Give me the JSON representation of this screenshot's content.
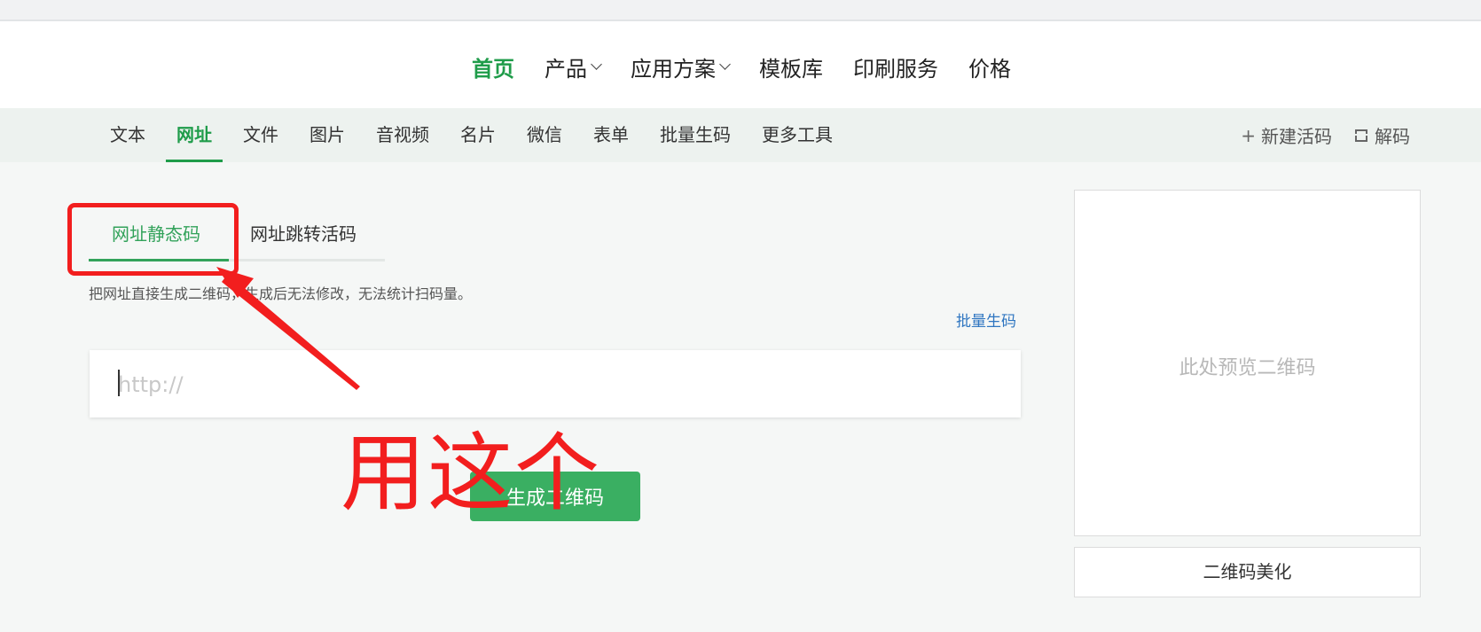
{
  "topnav": {
    "items": [
      {
        "label": "首页",
        "active": true,
        "dropdown": false
      },
      {
        "label": "产品",
        "active": false,
        "dropdown": true
      },
      {
        "label": "应用方案",
        "active": false,
        "dropdown": true
      },
      {
        "label": "模板库",
        "active": false,
        "dropdown": false
      },
      {
        "label": "印刷服务",
        "active": false,
        "dropdown": false
      },
      {
        "label": "价格",
        "active": false,
        "dropdown": false
      }
    ]
  },
  "category_tabs": {
    "items": [
      "文本",
      "网址",
      "文件",
      "图片",
      "音视频",
      "名片",
      "微信",
      "表单",
      "批量生码",
      "更多工具"
    ],
    "active_index": 1
  },
  "tools": {
    "new_live_code": "新建活码",
    "decode": "解码"
  },
  "sub_tabs": {
    "static": "网址静态码",
    "dynamic": "网址跳转活码"
  },
  "description": "把网址直接生成二维码，生成后无法修改，无法统计扫码量。",
  "batch_link": "批量生码",
  "url_input": {
    "placeholder": "http://",
    "value": ""
  },
  "generate_button": "生成二维码",
  "preview": {
    "placeholder": "此处预览二维码"
  },
  "beautify_button": "二维码美化",
  "annotation": {
    "text": "用这个",
    "color": "#f21e1e"
  },
  "colors": {
    "brand_green": "#1f9c4a",
    "button_green": "#3aaf62",
    "link_blue": "#2f76c1"
  }
}
